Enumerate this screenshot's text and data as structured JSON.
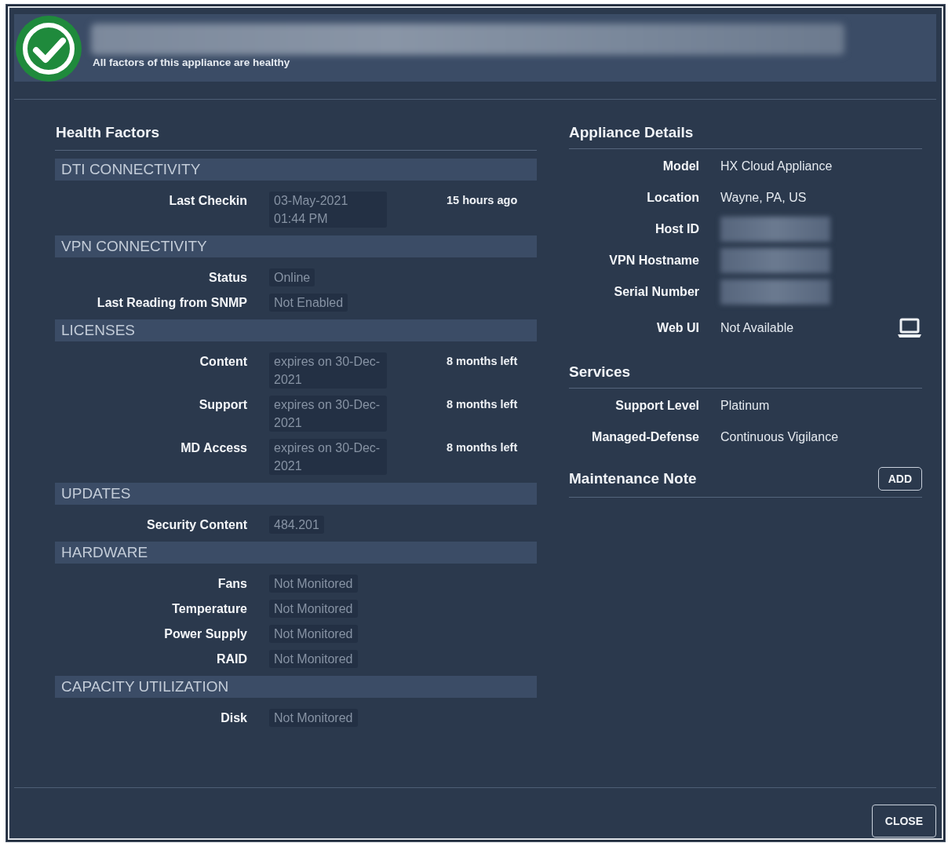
{
  "header": {
    "healthy": true,
    "title_redacted": true,
    "status": "All factors of this appliance are healthy"
  },
  "health_factors": {
    "title": "Health Factors",
    "sections": [
      {
        "title": "DTI CONNECTIVITY",
        "rows": [
          {
            "label": "Last Checkin",
            "value": "03-May-2021 01:44 PM",
            "note": "15 hours ago"
          }
        ]
      },
      {
        "title": "VPN CONNECTIVITY",
        "rows": [
          {
            "label": "Status",
            "value": "Online"
          },
          {
            "label": "Last Reading from SNMP",
            "value": "Not Enabled"
          }
        ]
      },
      {
        "title": "LICENSES",
        "rows": [
          {
            "label": "Content",
            "value": "expires on 30-Dec-2021",
            "note": "8 months left"
          },
          {
            "label": "Support",
            "value": "expires on 30-Dec-2021",
            "note": "8 months left"
          },
          {
            "label": "MD Access",
            "value": "expires on 30-Dec-2021",
            "note": "8 months left"
          }
        ]
      },
      {
        "title": "UPDATES",
        "rows": [
          {
            "label": "Security Content",
            "value": "484.201"
          }
        ]
      },
      {
        "title": "HARDWARE",
        "rows": [
          {
            "label": "Fans",
            "value": "Not Monitored"
          },
          {
            "label": "Temperature",
            "value": "Not Monitored"
          },
          {
            "label": "Power Supply",
            "value": "Not Monitored"
          },
          {
            "label": "RAID",
            "value": "Not Monitored"
          }
        ]
      },
      {
        "title": "CAPACITY UTILIZATION",
        "rows": [
          {
            "label": "Disk",
            "value": "Not Monitored"
          }
        ]
      }
    ]
  },
  "appliance_details": {
    "title": "Appliance Details",
    "rows": [
      {
        "kind": "text",
        "label": "Model",
        "value": "HX Cloud Appliance"
      },
      {
        "kind": "text",
        "label": "Location",
        "value": "Wayne, PA, US"
      },
      {
        "kind": "redacted",
        "label": "Host ID"
      },
      {
        "kind": "redacted",
        "label": "VPN Hostname"
      },
      {
        "kind": "redacted",
        "label": "Serial Number"
      },
      {
        "kind": "laptop",
        "label": "Web UI",
        "value": "Not Available"
      }
    ]
  },
  "services": {
    "title": "Services",
    "rows": [
      {
        "kind": "text",
        "label": "Support Level",
        "value": "Platinum"
      },
      {
        "kind": "text",
        "label": "Managed-Defense",
        "value": "Continuous Vigilance"
      }
    ]
  },
  "maintenance_note": {
    "title": "Maintenance Note",
    "button": "ADD"
  },
  "footer": {
    "button": "CLOSE"
  }
}
